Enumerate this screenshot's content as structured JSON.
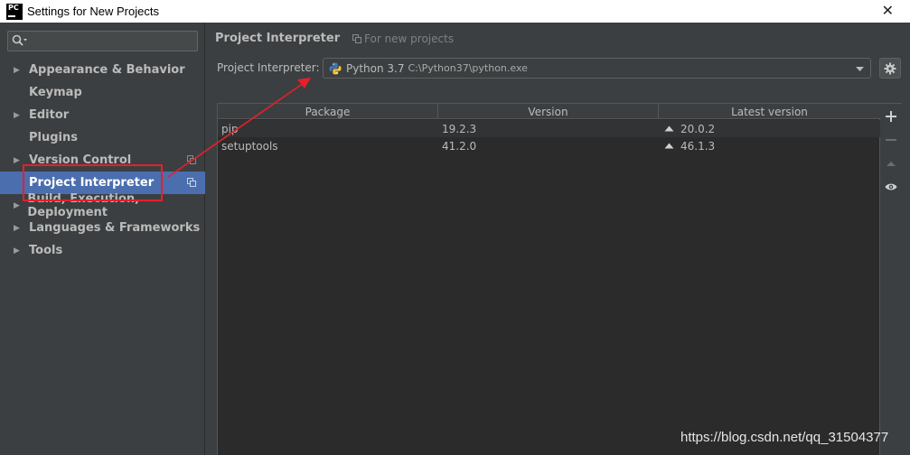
{
  "window": {
    "title": "Settings for New Projects",
    "logo_text": "PC",
    "close_glyph": "✕"
  },
  "sidebar": {
    "search": {
      "value": "",
      "placeholder": ""
    },
    "items": [
      {
        "label": "Appearance & Behavior",
        "expandable": true
      },
      {
        "label": "Keymap",
        "expandable": false
      },
      {
        "label": "Editor",
        "expandable": true
      },
      {
        "label": "Plugins",
        "expandable": false
      },
      {
        "label": "Version Control",
        "expandable": true
      },
      {
        "label": "Project Interpreter",
        "expandable": false,
        "selected": true
      },
      {
        "label": "Build, Execution, Deployment",
        "expandable": true
      },
      {
        "label": "Languages & Frameworks",
        "expandable": true
      },
      {
        "label": "Tools",
        "expandable": true
      }
    ],
    "arrow_glyph": "▶"
  },
  "main": {
    "title": "Project Interpreter",
    "for_new_projects": "For new projects",
    "interpreter_label": "Project Interpreter:",
    "interpreter_name": "Python 3.7",
    "interpreter_path": "C:\\Python37\\python.exe",
    "table": {
      "headers": [
        "Package",
        "Version",
        "Latest version"
      ],
      "rows": [
        {
          "package": "pip",
          "version": "19.2.3",
          "latest": "20.0.2"
        },
        {
          "package": "setuptools",
          "version": "41.2.0",
          "latest": "46.1.3"
        }
      ]
    }
  },
  "watermark": "https://blog.csdn.net/qq_31504377",
  "colors": {
    "background": "#3c3f41",
    "selection": "#4b6eaf",
    "table_bg": "#2b2b2b",
    "annotation": "#e5202a"
  },
  "icons": [
    "search-icon",
    "copy-icon",
    "python-icon",
    "chevron-down-icon",
    "gear-icon",
    "plus-icon",
    "minus-icon",
    "up-arrow-icon",
    "eye-icon",
    "close-icon"
  ]
}
